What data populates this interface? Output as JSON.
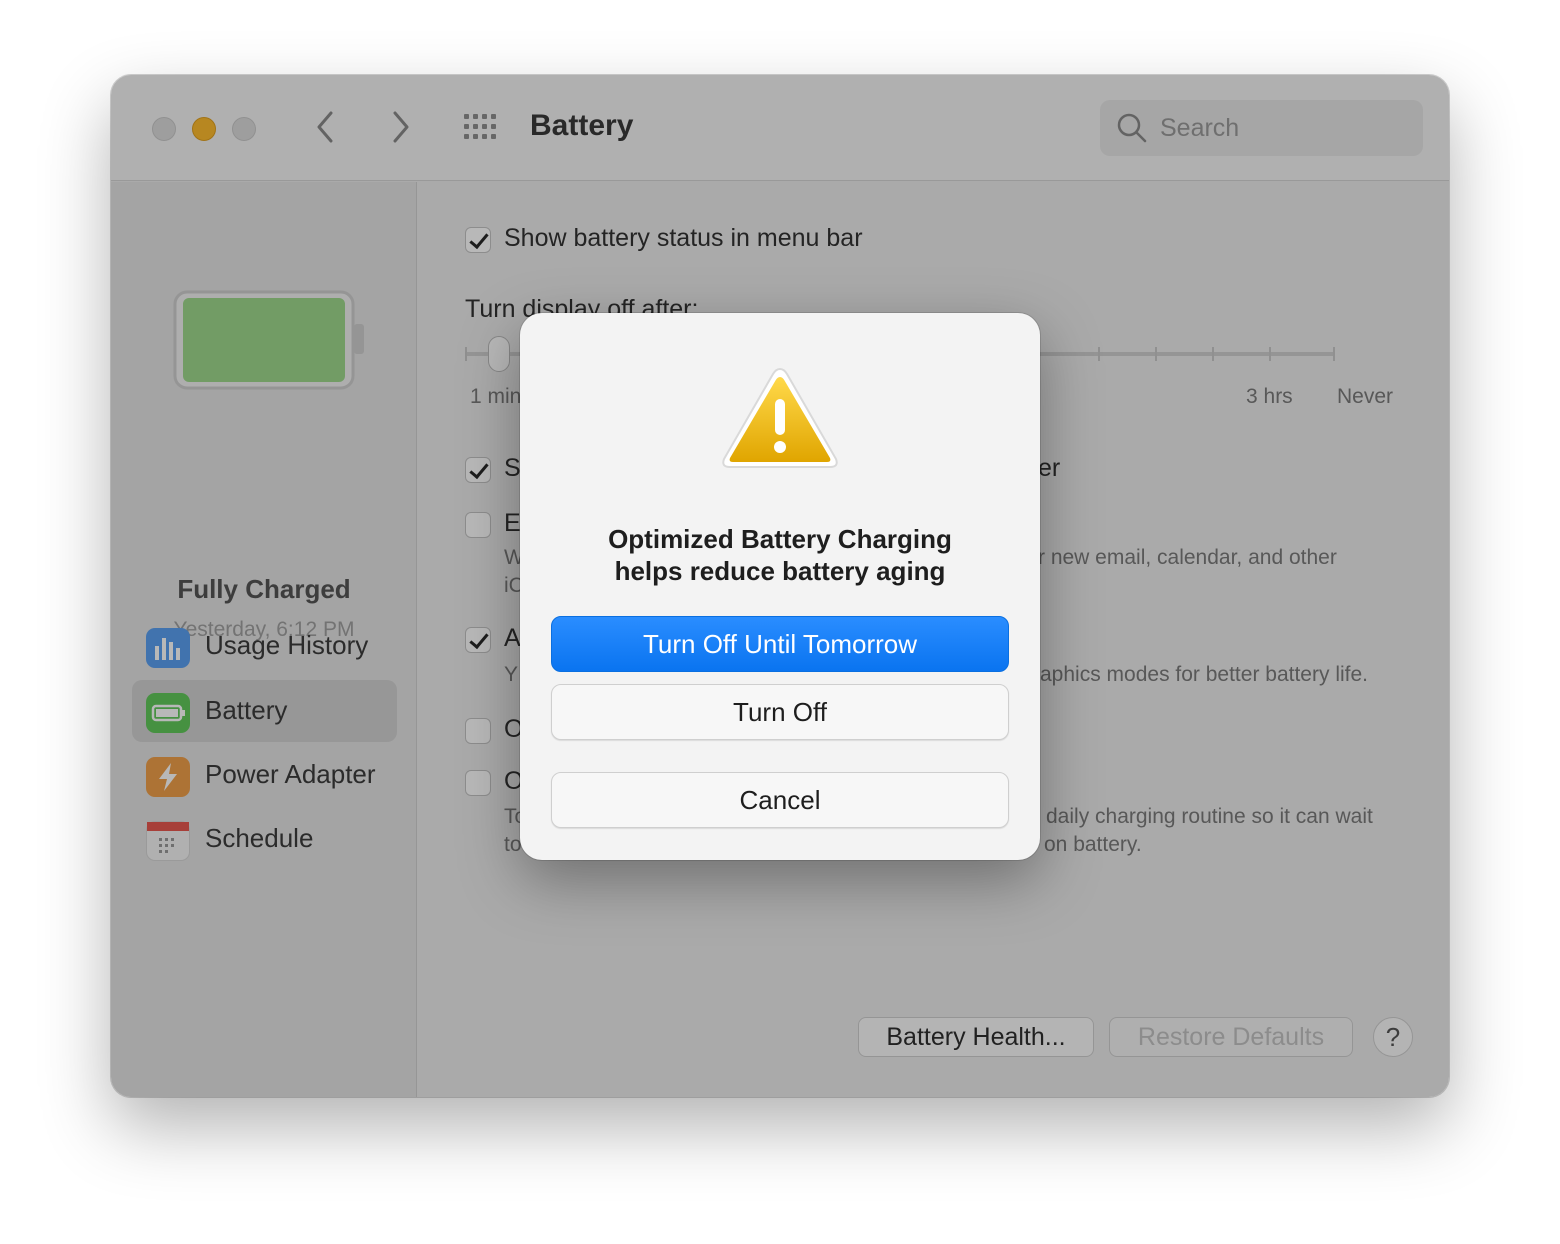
{
  "window": {
    "title": "Battery",
    "search_placeholder": "Search"
  },
  "sidebar": {
    "status_title": "Fully Charged",
    "status_time": "Yesterday, 6:12 PM",
    "items": [
      {
        "label": "Usage History",
        "icon": "bar-chart-icon"
      },
      {
        "label": "Battery",
        "icon": "battery-icon",
        "selected": true
      },
      {
        "label": "Power Adapter",
        "icon": "lightning-icon"
      },
      {
        "label": "Schedule",
        "icon": "calendar-icon"
      }
    ]
  },
  "main": {
    "show_status_label": "Show battery status in menu bar",
    "show_status_checked": true,
    "display_off_label": "Turn display off after:",
    "slider_labels": {
      "min": "1 min",
      "hrs": "3 hrs",
      "never": "Never"
    },
    "partial_texts": {
      "row1_prefix": "S",
      "row1_suffix": "er",
      "row2_prefix": "E",
      "row2_desc_prefix": "W",
      "row2_desc_prefix2": "iC",
      "row2_desc_suffix": "r new email, calendar, and other",
      "row3_prefix": "A",
      "row3_desc_prefix": "Y",
      "row3_desc_suffix": "aphics modes for better battery life.",
      "row4_prefix": "O",
      "row5_prefix": "O",
      "row5_desc_prefix": "To",
      "row5_desc_prefix2": "to",
      "row5_desc_suffix": "daily charging routine so it can wait",
      "row5_desc_suffix2": "on battery."
    },
    "battery_health_label": "Battery Health...",
    "restore_defaults_label": "Restore Defaults",
    "help_label": "?"
  },
  "dialog": {
    "title_line1": "Optimized Battery Charging",
    "title_line2": "helps reduce battery aging",
    "primary_label": "Turn Off Until Tomorrow",
    "turn_off_label": "Turn Off",
    "cancel_label": "Cancel",
    "icon": "warning-icon"
  },
  "colors": {
    "accent": "#0a74f0",
    "minimize": "#febc2e",
    "battery_fill": "#8fd07e"
  }
}
